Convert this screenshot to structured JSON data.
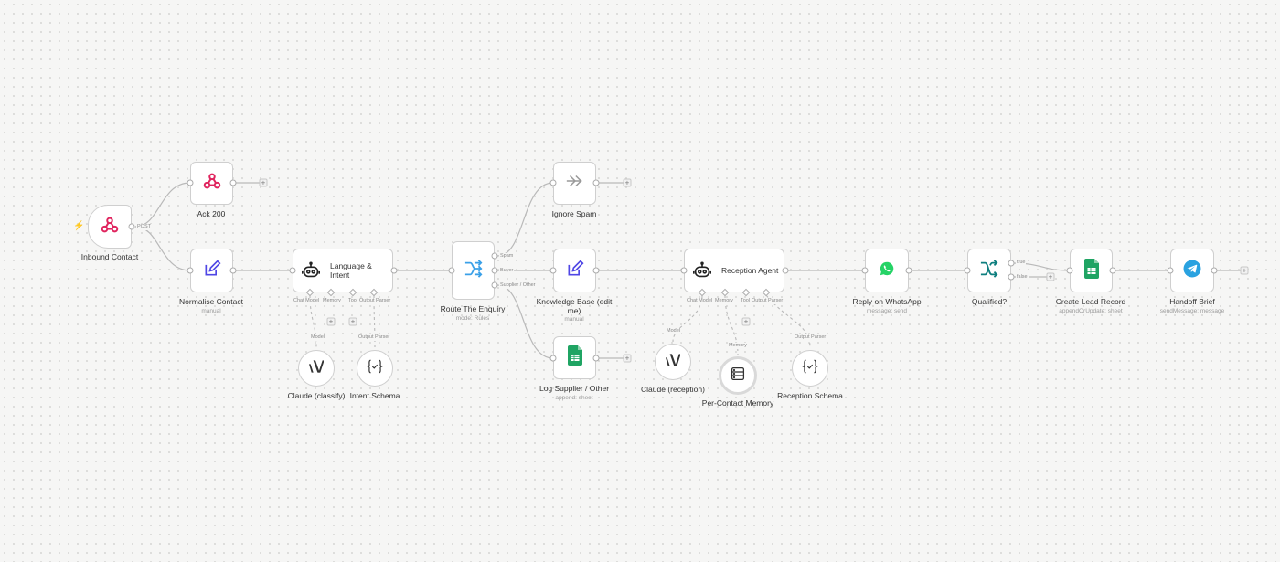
{
  "canvas": {
    "accent_color": "#ff6d5a",
    "webhook_color": "#e0245e",
    "edit_color": "#4f46e5",
    "route_color": "#3aa0e8",
    "sheets_color": "#1fa463",
    "whatsapp_color": "#25d366",
    "telegram_color": "#2aa2e0",
    "if_color": "#0f7f7f"
  },
  "nodes": {
    "inbound_contact": {
      "label": "Inbound Contact",
      "output_tag": "POST",
      "icon": "webhook-icon"
    },
    "ack_200": {
      "label": "Ack 200",
      "icon": "webhook-icon"
    },
    "normalise_contact": {
      "label": "Normalise Contact",
      "sub": "manual",
      "icon": "edit-icon"
    },
    "language_intent": {
      "label": "Language & Intent",
      "icon": "robot-icon",
      "ports": {
        "chat_model": "Chat Model",
        "memory": "Memory",
        "tool": "Tool",
        "output_parser": "Output Parser"
      }
    },
    "route_enquiry": {
      "label": "Route The Enquiry",
      "sub": "mode: Rules",
      "outputs": {
        "spam": "Spam",
        "buyer": "Buyer",
        "supplier": "Supplier / Other"
      },
      "icon": "route-icon"
    },
    "ignore_spam": {
      "label": "Ignore Spam",
      "icon": "arrow-right-icon"
    },
    "knowledge_base": {
      "label": "Knowledge Base (edit me)",
      "sub": "manual",
      "icon": "edit-icon"
    },
    "log_supplier": {
      "label": "Log Supplier / Other",
      "sub": "append: sheet",
      "icon": "sheets-icon"
    },
    "reception_agent": {
      "label": "Reception Agent",
      "icon": "robot-icon",
      "ports": {
        "chat_model": "Chat Model",
        "memory": "Memory",
        "tool": "Tool",
        "output_parser": "Output Parser"
      }
    },
    "reply_whatsapp": {
      "label": "Reply on WhatsApp",
      "sub": "message: send",
      "icon": "whatsapp-icon"
    },
    "qualified": {
      "label": "Qualified?",
      "outputs": {
        "true": "true",
        "false": "false"
      },
      "icon": "if-icon"
    },
    "create_lead": {
      "label": "Create Lead Record",
      "sub": "appendOrUpdate: sheet",
      "icon": "sheets-icon"
    },
    "handoff_brief": {
      "label": "Handoff Brief",
      "sub": "sendMessage: message",
      "icon": "telegram-icon"
    }
  },
  "subnodes": {
    "claude_classify": {
      "label": "Claude (classify)",
      "tag": "Model",
      "icon": "anthropic-icon"
    },
    "intent_schema": {
      "label": "Intent Schema",
      "tag": "Output Parser",
      "icon": "braces-icon"
    },
    "claude_reception": {
      "label": "Claude (reception)",
      "tag": "Model",
      "icon": "anthropic-icon"
    },
    "per_contact_memory": {
      "label": "Per-Contact Memory",
      "tag": "Memory",
      "icon": "database-icon"
    },
    "reception_schema": {
      "label": "Reception Schema",
      "tag": "Output Parser",
      "icon": "braces-icon"
    }
  },
  "add_symbol": "+"
}
